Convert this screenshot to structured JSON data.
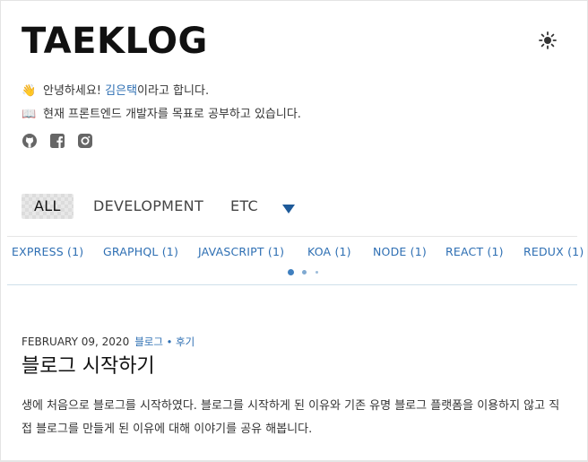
{
  "header": {
    "logo": "TAEKLOG",
    "theme_icon": "sun-icon"
  },
  "bio": {
    "greeting_emoji": "👋",
    "greeting_prefix": "안녕하세요! ",
    "greeting_link": "김은택",
    "greeting_suffix": "이라고 합니다.",
    "desc_emoji": "📖",
    "desc": "현재 프론트엔드 개발자를 목표로 공부하고 있습니다."
  },
  "socials": [
    "github-icon",
    "facebook-icon",
    "instagram-icon"
  ],
  "tabs": {
    "items": [
      "ALL",
      "DEVELOPMENT",
      "ETC"
    ],
    "active": "ALL",
    "dropdown_icon": "triangle-down-icon"
  },
  "categories": [
    "EXPRESS (1)",
    "GRAPHQL (1)",
    "JAVASCRIPT (1)",
    "KOA (1)",
    "NODE (1)",
    "REACT (1)",
    "REDUX (1)"
  ],
  "pagination": {
    "pages": 3,
    "current": 1
  },
  "posts": [
    {
      "date": "FEBRUARY 09, 2020",
      "category": "블로그 • 후기",
      "title": "블로그 시작하기",
      "excerpt": "생에 처음으로 블로그를 시작하였다. 블로그를 시작하게 된 이유와 기존 유명 블로그 플랫폼을 이용하지 않고 직접 블로그를 만들게 된 이유에 대해 이야기를 공유 해봅니다."
    }
  ],
  "colors": {
    "link": "#2e6fb3",
    "dropdown": "#1e5a99",
    "text": "#222222"
  }
}
